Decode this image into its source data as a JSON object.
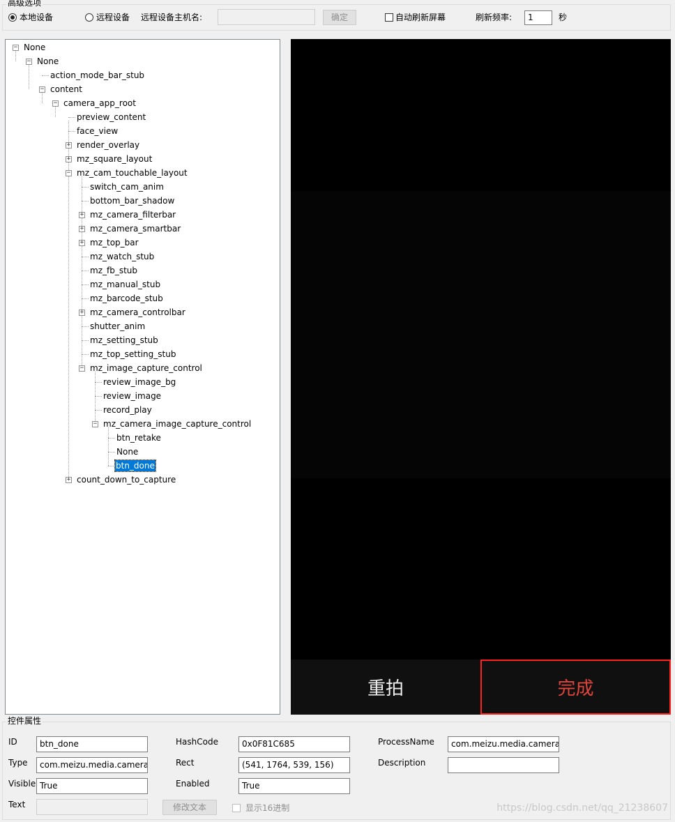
{
  "advanced": {
    "title": "高级选项",
    "local_device": "本地设备",
    "remote_device": "远程设备",
    "remote_host_label": "远程设备主机名:",
    "remote_host_value": "",
    "confirm_button": "确定",
    "auto_refresh": "自动刷新屏幕",
    "refresh_rate_label": "刷新频率:",
    "refresh_rate_value": "1",
    "seconds": "秒"
  },
  "tree": [
    {
      "label": "None"
    },
    {
      "label": "None"
    },
    {
      "label": "action_mode_bar_stub"
    },
    {
      "label": "content"
    },
    {
      "label": "camera_app_root"
    },
    {
      "label": "preview_content"
    },
    {
      "label": "face_view"
    },
    {
      "label": "render_overlay"
    },
    {
      "label": "mz_square_layout"
    },
    {
      "label": "mz_cam_touchable_layout"
    },
    {
      "label": "switch_cam_anim"
    },
    {
      "label": "bottom_bar_shadow"
    },
    {
      "label": "mz_camera_filterbar"
    },
    {
      "label": "mz_camera_smartbar"
    },
    {
      "label": "mz_top_bar"
    },
    {
      "label": "mz_watch_stub"
    },
    {
      "label": "mz_fb_stub"
    },
    {
      "label": "mz_manual_stub"
    },
    {
      "label": "mz_barcode_stub"
    },
    {
      "label": "mz_camera_controlbar"
    },
    {
      "label": "shutter_anim"
    },
    {
      "label": "mz_setting_stub"
    },
    {
      "label": "mz_top_setting_stub"
    },
    {
      "label": "mz_image_capture_control"
    },
    {
      "label": "review_image_bg"
    },
    {
      "label": "review_image"
    },
    {
      "label": "record_play"
    },
    {
      "label": "mz_camera_image_capture_control"
    },
    {
      "label": "btn_retake"
    },
    {
      "label": "None"
    },
    {
      "label": "btn_done"
    },
    {
      "label": "count_down_to_capture"
    }
  ],
  "screen": {
    "retake_label": "重拍",
    "done_label": "完成"
  },
  "props": {
    "title": "控件属性",
    "id_label": "ID",
    "id_value": "btn_done",
    "type_label": "Type",
    "type_value": "com.meizu.media.camera.v",
    "visible_label": "Visible",
    "visible_value": "True",
    "text_label": "Text",
    "text_value": "",
    "hashcode_label": "HashCode",
    "hashcode_value": "0x0F81C685",
    "rect_label": "Rect",
    "rect_value": "(541, 1764, 539, 156)",
    "enabled_label": "Enabled",
    "enabled_value": "True",
    "modify_text_button": "修改文本",
    "hex_label": "显示16进制",
    "process_label": "ProcessName",
    "process_value": "com.meizu.media.camera",
    "description_label": "Description",
    "description_value": ""
  },
  "watermark": "https://blog.csdn.net/qq_21238607"
}
